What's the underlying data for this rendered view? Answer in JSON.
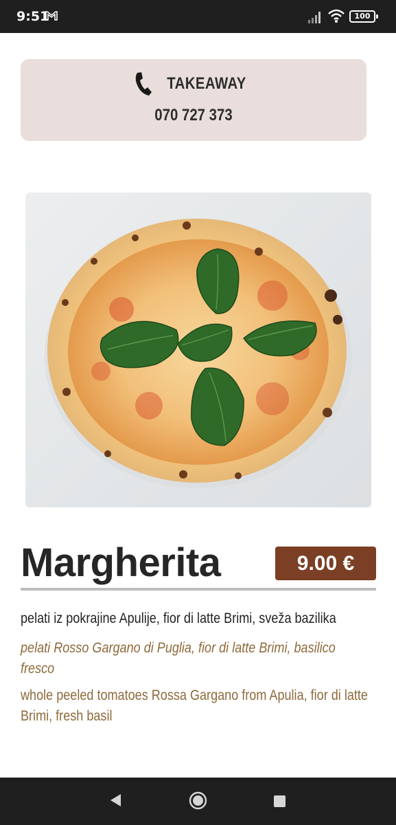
{
  "status_bar": {
    "time": "9:51",
    "mail_icon": "gmail-m-icon",
    "signal_icon": "signal-icon",
    "wifi_icon": "wifi-icon",
    "battery": "100"
  },
  "takeaway": {
    "icon": "phone-icon",
    "label": "TAKEAWAY",
    "phone": "070 727 373"
  },
  "item": {
    "image": "pizza-margherita-photo",
    "name": "Margherita",
    "price": "9.00 €",
    "description_si": "pelati iz pokrajine Apulije, fior di latte Brimi, sveža bazilika",
    "description_it": "pelati Rosso Gargano di Puglia, fior di latte Brimi, basilico fresco",
    "description_en": "whole peeled tomatoes Rossa Gargano from Apulia, fior di latte Brimi, fresh basil"
  },
  "colors": {
    "card_background": "#e9dedb",
    "price_badge": "#7a3f24",
    "accent_text": "#8e6a3b"
  },
  "nav_bar": {
    "back_icon": "back-triangle-icon",
    "home_icon": "home-circle-icon",
    "recents_icon": "recents-square-icon"
  }
}
